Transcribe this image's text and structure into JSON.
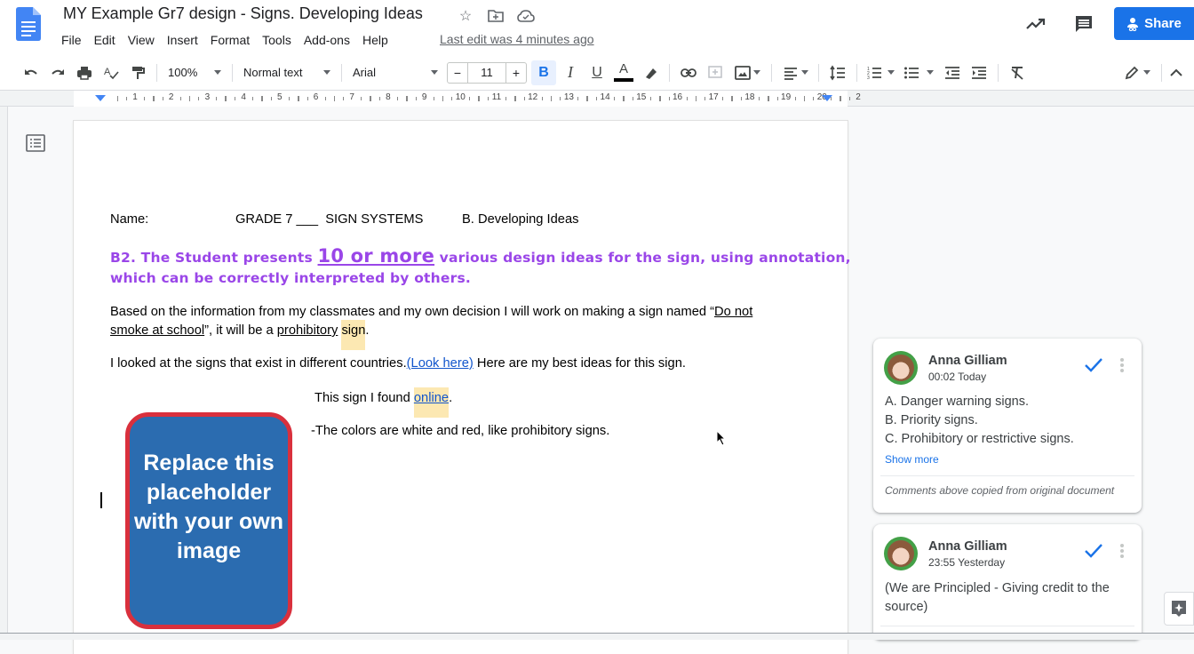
{
  "header": {
    "title": "MY Example Gr7 design - Signs. Developing Ideas",
    "title_icons": [
      "star-icon",
      "move-to-folder-icon",
      "cloud-saved-icon"
    ],
    "menu": [
      "File",
      "Edit",
      "View",
      "Insert",
      "Format",
      "Tools",
      "Add-ons",
      "Help"
    ],
    "last_edit": "Last edit was 4 minutes ago",
    "share_label": "Share",
    "brand_color": "#1a73e8"
  },
  "toolbar": {
    "zoom": "100%",
    "style": "Normal text",
    "font": "Arial",
    "font_size": "11",
    "bold_active": true,
    "text_color": "#000000"
  },
  "ruler": {
    "numbers": [
      "1",
      "2",
      "3",
      "4",
      "5",
      "6",
      "7",
      "8",
      "9",
      "10",
      "11",
      "12",
      "13",
      "14",
      "15",
      "16",
      "17",
      "18",
      "19",
      "20",
      "2"
    ]
  },
  "document": {
    "header_line": {
      "name_label": "Name:",
      "grade": "GRADE 7 ___  SIGN SYSTEMS",
      "section": "B. Developing Ideas"
    },
    "criterion": {
      "prefix": "B2. The Student presents ",
      "emphasis": "10 or more",
      "suffix": " various design ideas for the sign, using annotation,",
      "line2": "which can be correctly interpreted by others.",
      "color": "#9a46e8"
    },
    "para1": {
      "line1_text": "Based on the information from my classmates and my own decision I will work on making a sign named “",
      "line1_underlined": "Do not",
      "line2_underlined": "smoke at school",
      "line2_mid": "”, it will be a ",
      "line2_prohibitory": "prohibitory",
      "line2_space": " ",
      "line2_highlight": "sign",
      "line2_end": "."
    },
    "para2": {
      "text": "I looked at the signs that exist in different countries.",
      "link": "(Look here)",
      "tail": " Here are my best ideas for this sign."
    },
    "caption": {
      "text": "This sign I found ",
      "link": "online",
      "end": "."
    },
    "note": "-The colors are white and red, like prohibitory signs.",
    "placeholder_text": "Replace this placeholder with your own image",
    "placeholder_colors": {
      "fill": "#2b6cb0",
      "border": "#d9303d"
    }
  },
  "comments": [
    {
      "author": "Anna Gilliam",
      "time": "00:02 Today",
      "lines": [
        "A. Danger warning signs.",
        "B. Priority signs.",
        "C. Prohibitory or restrictive signs."
      ],
      "show_more": "Show more",
      "note": "Comments above copied from original document"
    },
    {
      "author": "Anna Gilliam",
      "time": "23:55 Yesterday",
      "lines": [
        "(We are Principled - Giving credit to the",
        "source)"
      ]
    }
  ]
}
